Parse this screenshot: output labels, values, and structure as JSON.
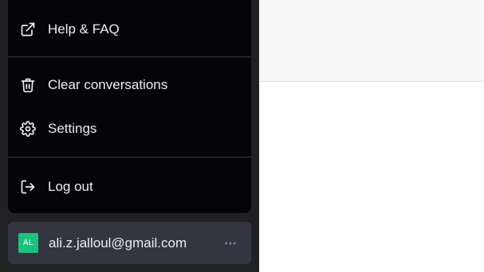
{
  "menu": {
    "items": [
      {
        "label": "Help & FAQ",
        "icon": "external-link-icon"
      },
      {
        "label": "Clear conversations",
        "icon": "trash-icon"
      },
      {
        "label": "Settings",
        "icon": "gear-icon"
      },
      {
        "label": "Log out",
        "icon": "logout-icon"
      }
    ]
  },
  "user": {
    "avatar_initials": "AL",
    "email": "ali.z.jalloul@gmail.com",
    "more_icon": "ellipsis-icon"
  },
  "colors": {
    "sidebar_bg": "#202123",
    "menu_bg": "#050509",
    "user_row_bg": "#343541",
    "avatar_bg": "#19c37d",
    "text": "#ececf1"
  }
}
